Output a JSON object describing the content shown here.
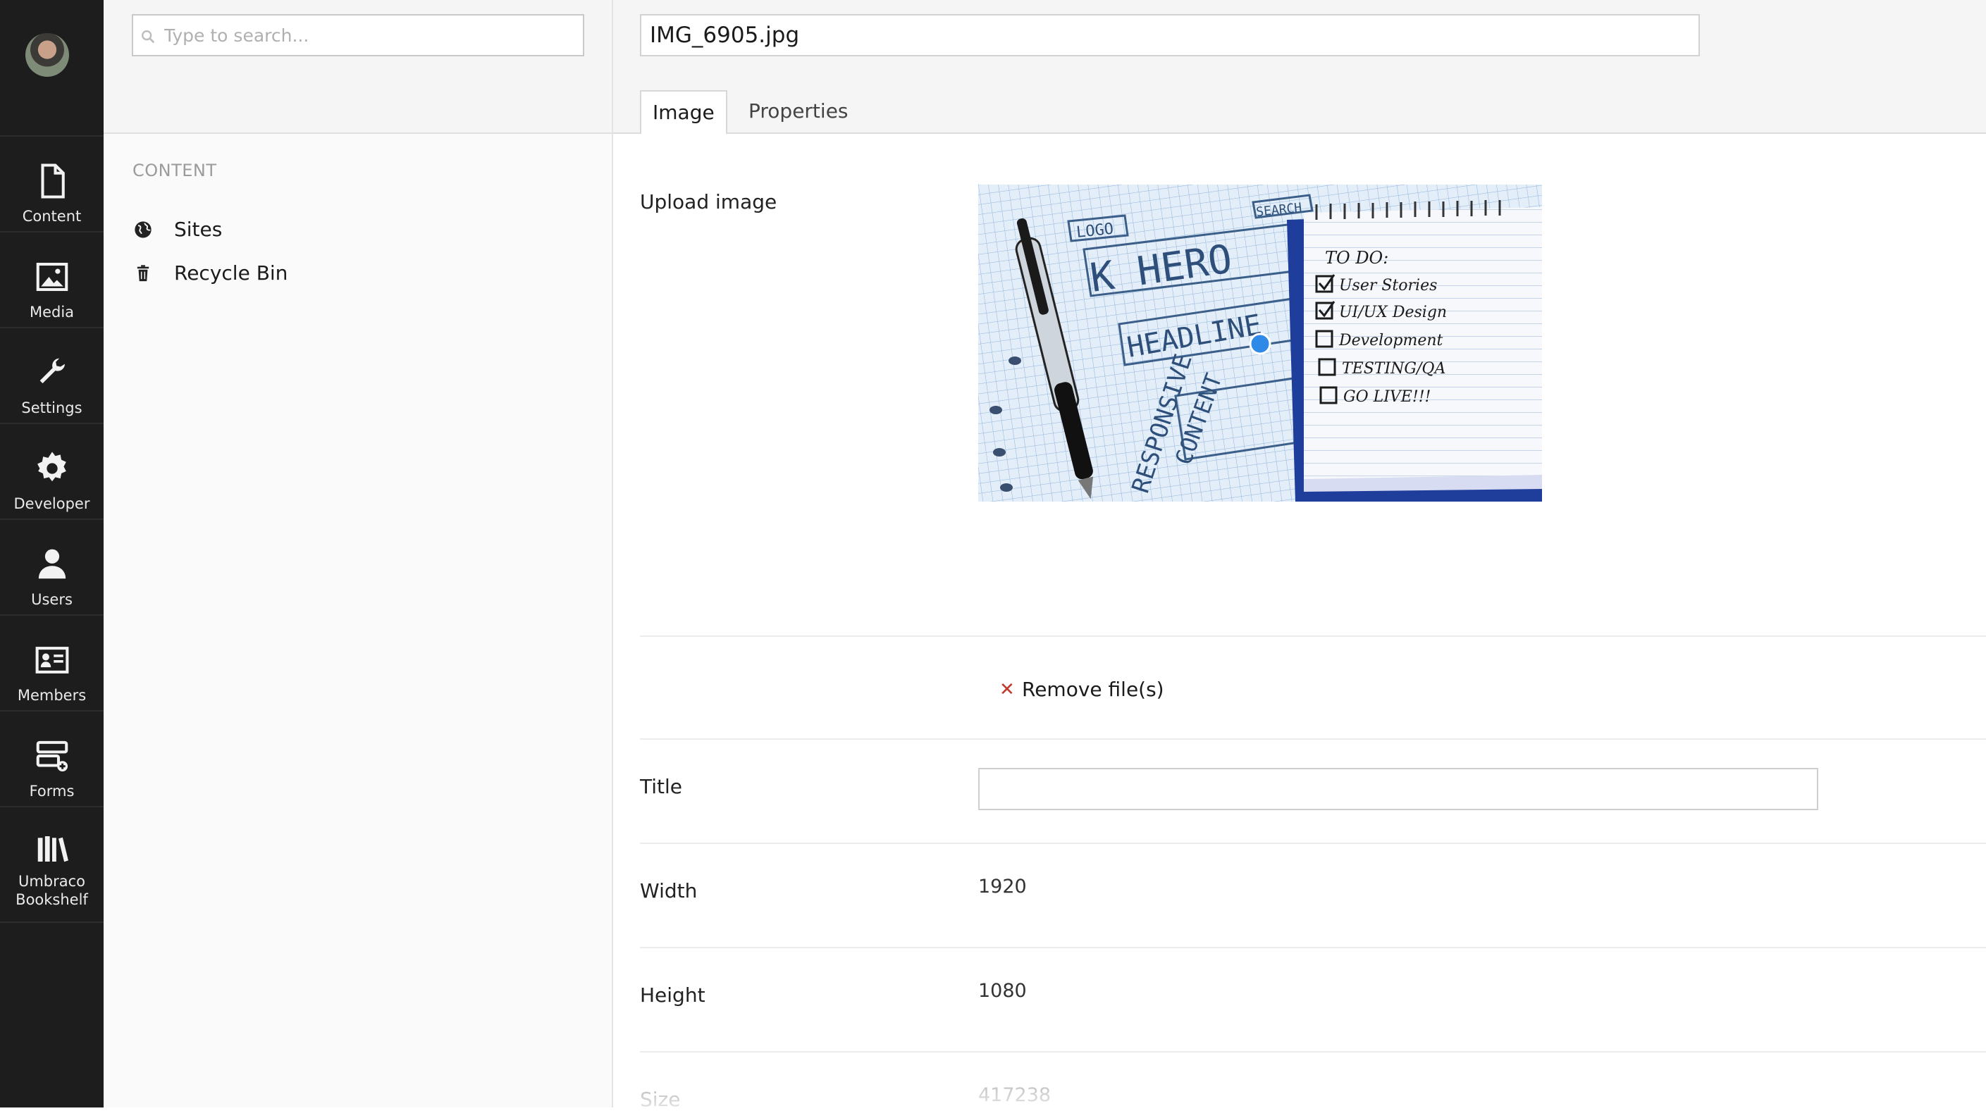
{
  "app_bar": {
    "sections": [
      {
        "label": "Content",
        "icon": "document-icon"
      },
      {
        "label": "Media",
        "icon": "image-icon"
      },
      {
        "label": "Settings",
        "icon": "wrench-icon"
      },
      {
        "label": "Developer",
        "icon": "gear-icon"
      },
      {
        "label": "Users",
        "icon": "user-icon"
      },
      {
        "label": "Members",
        "icon": "id-card-icon"
      },
      {
        "label": "Forms",
        "icon": "forms-icon"
      },
      {
        "label": "Umbraco\nBookshelf",
        "icon": "books-icon"
      }
    ]
  },
  "tree": {
    "search_placeholder": "Type to search...",
    "section_title": "CONTENT",
    "items": [
      {
        "label": "Sites",
        "icon": "globe-icon"
      },
      {
        "label": "Recycle Bin",
        "icon": "trash-icon"
      }
    ]
  },
  "editor": {
    "name": "IMG_6905.jpg",
    "tabs": [
      {
        "label": "Image",
        "active": true
      },
      {
        "label": "Properties",
        "active": false
      }
    ],
    "upload_label": "Upload image",
    "remove_label": "Remove file(s)",
    "title_label": "Title",
    "title_value": "",
    "width_label": "Width",
    "width_value": "1920",
    "height_label": "Height",
    "height_value": "1080",
    "size_label": "Size",
    "size_value": "417238"
  },
  "colors": {
    "app_bar_bg": "#1d1d1d",
    "remove_icon": "#c0392b",
    "focal_point": "#2e8ae6"
  }
}
